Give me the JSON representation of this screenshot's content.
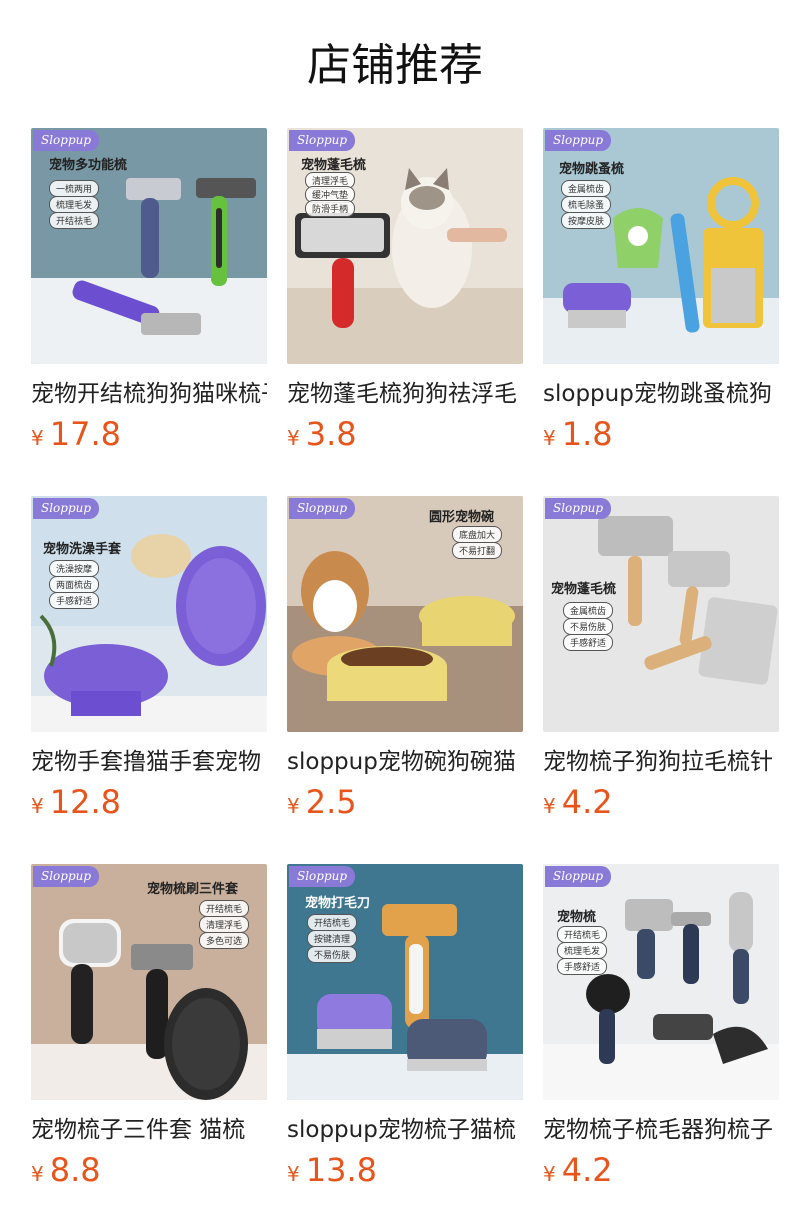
{
  "page": {
    "title": "店铺推荐"
  },
  "brand_tag": "Sloppup",
  "currency": "¥",
  "products": [
    {
      "name": "宠物开结梳狗狗猫咪梳子",
      "price": "17.8",
      "heading": "宠物多功能梳",
      "pills": [
        "一梳两用",
        "梳理毛发",
        "开结祛毛"
      ],
      "bg": "#7898a6"
    },
    {
      "name": "宠物蓬毛梳狗狗祛浮毛",
      "price": "3.8",
      "heading": "宠物蓬毛梳",
      "pills": [
        "清理浮毛",
        "缓冲气垫",
        "防滑手柄"
      ],
      "bg": "#e9e2d8"
    },
    {
      "name": "sloppup宠物跳蚤梳狗",
      "price": "1.8",
      "heading": "宠物跳蚤梳",
      "pills": [
        "金属梳齿",
        "梳毛除蚤",
        "按摩皮肤"
      ],
      "bg": "#a9c8d4"
    },
    {
      "name": "宠物手套撸猫手套宠物",
      "price": "12.8",
      "heading": "宠物洗澡手套",
      "pills": [
        "洗澡按摩",
        "两面梳齿",
        "手感舒适"
      ],
      "bg": "#dfe7ee"
    },
    {
      "name": "sloppup宠物碗狗碗猫",
      "price": "2.5",
      "heading": "圆形宠物碗",
      "pills": [
        "底盘加大",
        "不易打翻"
      ],
      "bg": "#bfae9c"
    },
    {
      "name": "宠物梳子狗狗拉毛梳针",
      "price": "4.2",
      "heading": "宠物蓬毛梳",
      "pills": [
        "金属梳齿",
        "不易伤肤",
        "手感舒适"
      ],
      "bg": "#e6e6e6"
    },
    {
      "name": "宠物梳子三件套 猫梳",
      "price": "8.8",
      "heading": "宠物梳刷三件套",
      "pills": [
        "开结梳毛",
        "清理浮毛",
        "多色可选"
      ],
      "bg": "#c9b09c"
    },
    {
      "name": "sloppup宠物梳子猫梳",
      "price": "13.8",
      "heading": "宠物打毛刀",
      "pills": [
        "开结梳毛",
        "按键清理",
        "不易伤肤"
      ],
      "bg": "#3f7690"
    },
    {
      "name": "宠物梳子梳毛器狗梳子",
      "price": "4.2",
      "heading": "宠物梳",
      "pills": [
        "开结梳毛",
        "梳理毛发",
        "手感舒适"
      ],
      "bg": "#eceef0"
    }
  ]
}
